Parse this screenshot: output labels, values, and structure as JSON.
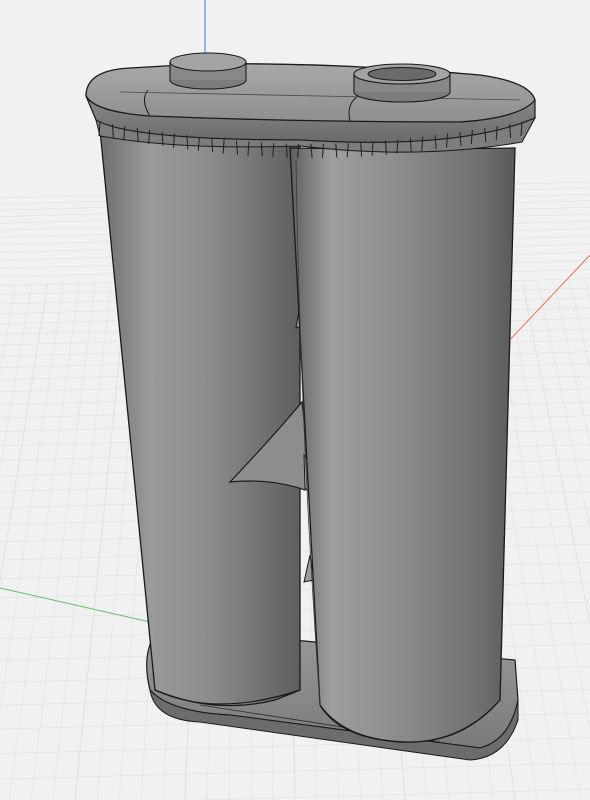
{
  "viewport": {
    "background": "#f1f1f1",
    "grid_minor_color": "#dedede",
    "grid_major_color": "#cfcfcf"
  },
  "axes": {
    "x_axis_color": "#e8705a",
    "y_axis_color": "#5fbf6f",
    "z_axis_color": "#4d8fe8"
  },
  "model": {
    "object": "twin-cylinder-holder",
    "body_color": "#8a8a8a",
    "edge_color": "#1a1a1a",
    "highlight_color": "#b6b6b6",
    "shadow_color": "#5a5a5a"
  }
}
